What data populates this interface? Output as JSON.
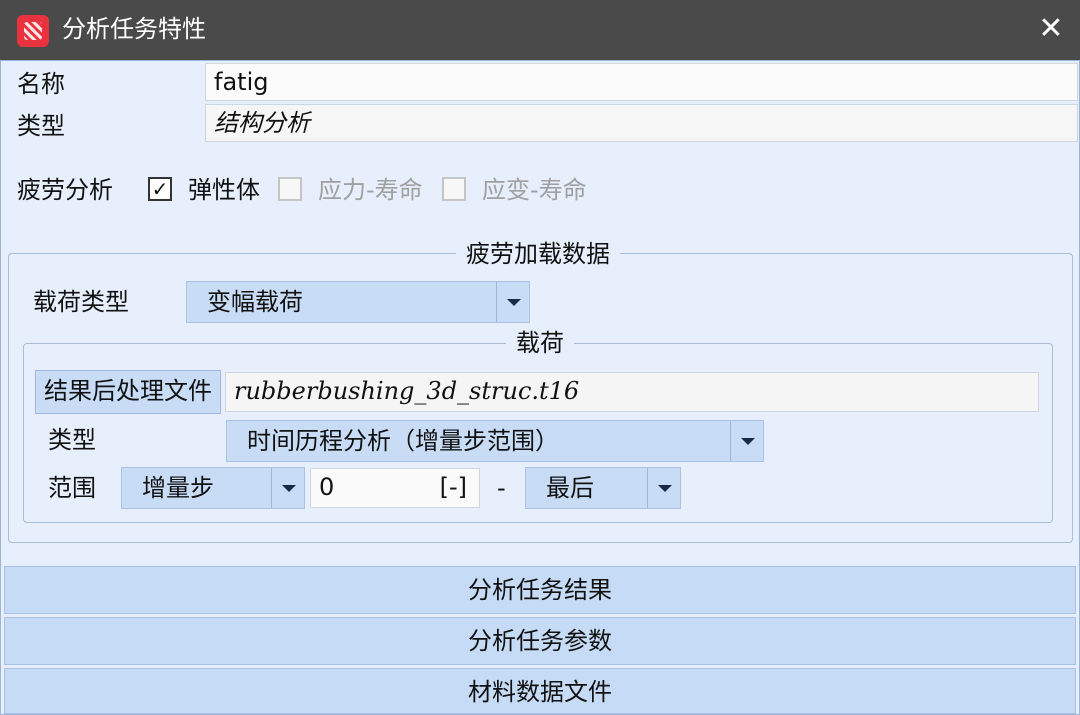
{
  "window": {
    "title": "分析任务特性",
    "close_symbol": "✕"
  },
  "fields": {
    "name_label": "名称",
    "name_value": "fatig",
    "type_label": "类型",
    "type_value": "结构分析"
  },
  "fatigue": {
    "label": "疲劳分析",
    "options": [
      {
        "label": "弹性体",
        "checked": true,
        "enabled": true
      },
      {
        "label": "应力-寿命",
        "checked": false,
        "enabled": false
      },
      {
        "label": "应变-寿命",
        "checked": false,
        "enabled": false
      }
    ]
  },
  "load_data": {
    "legend": "疲劳加载数据",
    "load_type_label": "载荷类型",
    "load_type_value": "变幅载荷",
    "load": {
      "legend": "载荷",
      "result_file_button": "结果后处理文件",
      "result_file_value": "rubberbushing_3d_struc.t16",
      "type_label": "类型",
      "type_value": "时间历程分析（增量步范围）",
      "range_label": "范围",
      "range_mode": "增量步",
      "range_start": "0",
      "range_unit": "[-]",
      "range_separator": "-",
      "range_end": "最后"
    }
  },
  "sections": [
    "分析任务结果",
    "分析任务参数",
    "材料数据文件"
  ],
  "icons": {
    "app": "app-logo-icon",
    "close": "close-icon",
    "dropdown": "chevron-down-icon",
    "check": "checkmark-icon"
  },
  "colors": {
    "titlebar": "#4a4a4a",
    "accent": "#c8dcf6",
    "app_icon": "#e8333e"
  }
}
